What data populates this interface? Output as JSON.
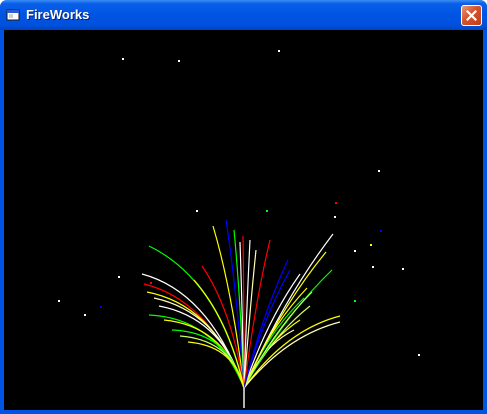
{
  "window": {
    "title": "FireWorks",
    "icon": "app-window-icon",
    "close_icon": "close-icon",
    "title_color": "#ffffff",
    "close_color": "#d5522c"
  },
  "canvas": {
    "background": "#000000",
    "spark_colors": [
      "#ffffff",
      "#ffff00",
      "#00ff00",
      "#ff0000",
      "#0000ff",
      "#c8ff64",
      "#ffffb4"
    ]
  }
}
